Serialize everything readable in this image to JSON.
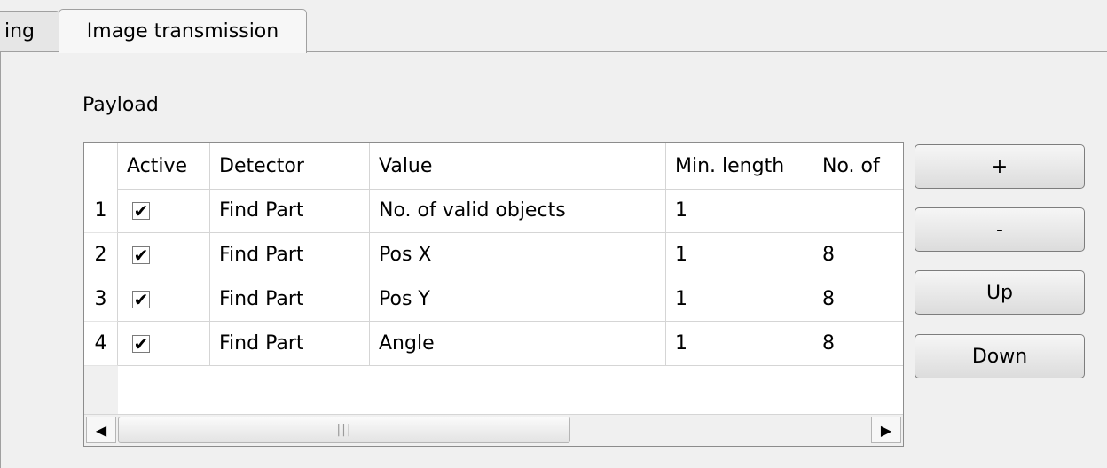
{
  "tabs": [
    {
      "label": "ing",
      "active": false
    },
    {
      "label": "Image transmission",
      "active": true
    }
  ],
  "payload_label": "Payload",
  "table": {
    "columns": [
      "Active",
      "Detector",
      "Value",
      "Min. length",
      "No. of"
    ],
    "rows": [
      {
        "num": "1",
        "active": "✔",
        "detector": "Find Part",
        "value": "No. of valid objects",
        "min_length": "1",
        "no_of": ""
      },
      {
        "num": "2",
        "active": "✔",
        "detector": "Find Part",
        "value": "Pos X",
        "min_length": "1",
        "no_of": "8"
      },
      {
        "num": "3",
        "active": "✔",
        "detector": "Find Part",
        "value": "Pos Y",
        "min_length": "1",
        "no_of": "8"
      },
      {
        "num": "4",
        "active": "✔",
        "detector": "Find Part",
        "value": "Angle",
        "min_length": "1",
        "no_of": "8"
      }
    ]
  },
  "scrollbar": {
    "left_arrow": "◀",
    "right_arrow": "▶",
    "grip": "|||"
  },
  "buttons": {
    "add": "+",
    "remove": "-",
    "up": "Up",
    "down": "Down"
  }
}
